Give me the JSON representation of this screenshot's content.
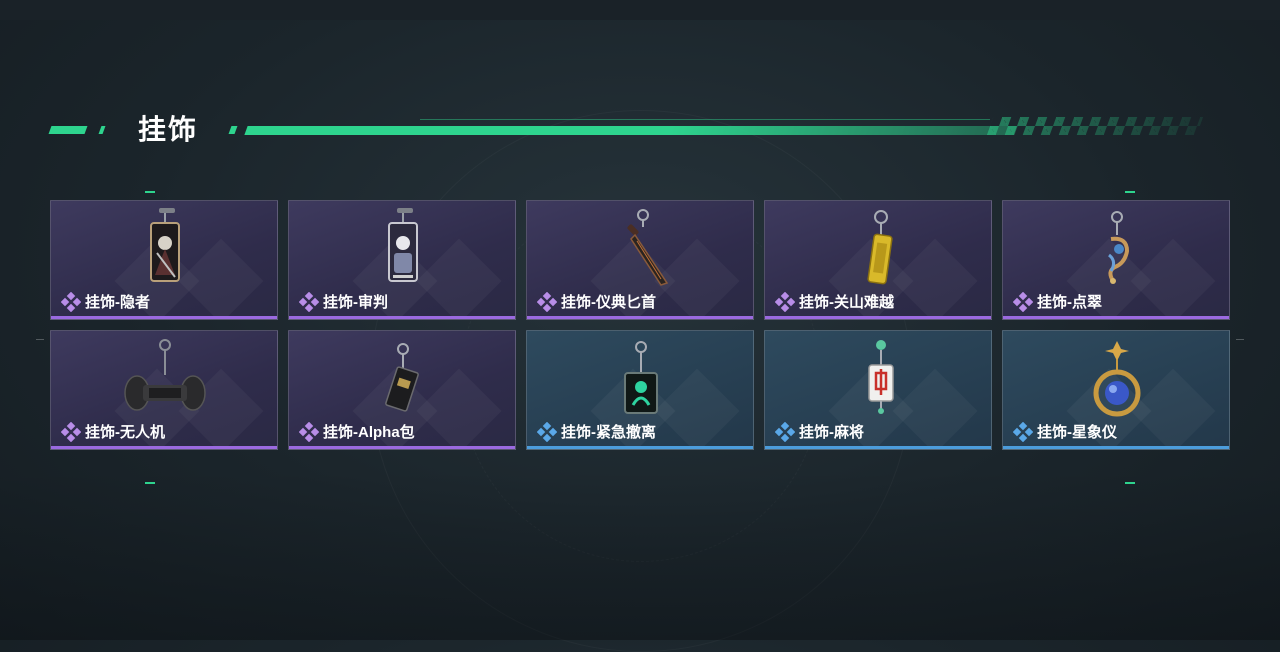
{
  "header": {
    "title": "挂饰"
  },
  "theme": {
    "accent": "#2ed48e",
    "purple_bar": "#9b6ae0",
    "blue_bar": "#4c9ddc"
  },
  "items": [
    {
      "label": "挂饰-隐者",
      "rarity": "purple",
      "icon": "tarot-card-hermit-icon"
    },
    {
      "label": "挂饰-审判",
      "rarity": "purple",
      "icon": "tarot-card-judgement-icon"
    },
    {
      "label": "挂饰-仪典匕首",
      "rarity": "purple",
      "icon": "ritual-dagger-icon"
    },
    {
      "label": "挂饰-关山难越",
      "rarity": "purple",
      "icon": "gold-tag-icon"
    },
    {
      "label": "挂饰-点翠",
      "rarity": "purple",
      "icon": "kingfisher-ornament-icon"
    },
    {
      "label": "挂饰-无人机",
      "rarity": "purple",
      "icon": "drone-icon"
    },
    {
      "label": "挂饰-Alpha包",
      "rarity": "purple",
      "icon": "alpha-pack-icon"
    },
    {
      "label": "挂饰-紧急撤离",
      "rarity": "blue",
      "icon": "emergency-evac-tag-icon"
    },
    {
      "label": "挂饰-麻将",
      "rarity": "blue",
      "icon": "mahjong-tile-icon"
    },
    {
      "label": "挂饰-星象仪",
      "rarity": "blue",
      "icon": "astrolabe-icon"
    }
  ]
}
